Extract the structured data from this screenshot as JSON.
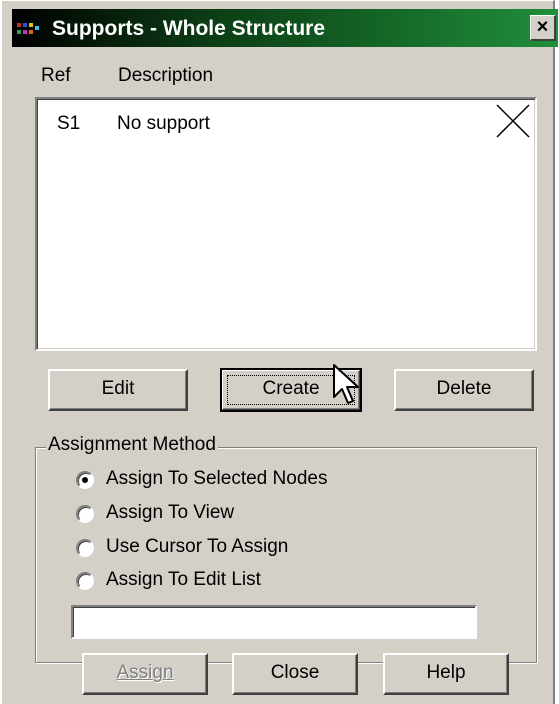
{
  "window": {
    "title": "Supports - Whole Structure",
    "close_glyph": "×",
    "title_gradient": [
      "#000000",
      "#1f8f3a"
    ],
    "face_color": "#d4d0c8"
  },
  "list": {
    "columns": {
      "ref": "Ref",
      "description": "Description"
    },
    "rows": [
      {
        "ref": "S1",
        "description": "No support",
        "icon": "x-cross-icon"
      }
    ]
  },
  "buttons": {
    "edit": "Edit",
    "create": "Create",
    "delete": "Delete",
    "assign": "Assign",
    "close": "Close",
    "help": "Help"
  },
  "assignment": {
    "group_label": "Assignment Method",
    "options": [
      {
        "label": "Assign To Selected Nodes",
        "selected": true
      },
      {
        "label": "Assign To View",
        "selected": false
      },
      {
        "label": "Use Cursor To Assign",
        "selected": false
      },
      {
        "label": "Assign To Edit List",
        "selected": false
      }
    ],
    "edit_list_value": ""
  }
}
